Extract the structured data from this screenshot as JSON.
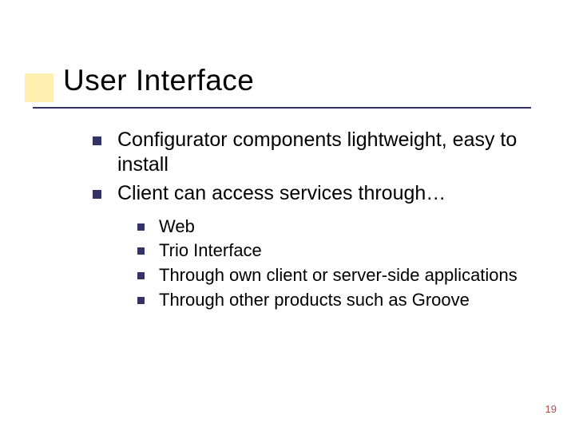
{
  "title": "User Interface",
  "bullets": [
    {
      "text": "Configurator components lightweight, easy to install"
    },
    {
      "text": "Client can access services through…"
    }
  ],
  "subbullets": [
    {
      "text": "Web"
    },
    {
      "text": "Trio Interface"
    },
    {
      "text": "Through own client or server-side applications"
    },
    {
      "text": "Through other products such as Groove"
    }
  ],
  "page_number": "19",
  "colors": {
    "accent": "#ffcc00",
    "bullet": "#333366",
    "pagenum": "#b84d4d"
  }
}
